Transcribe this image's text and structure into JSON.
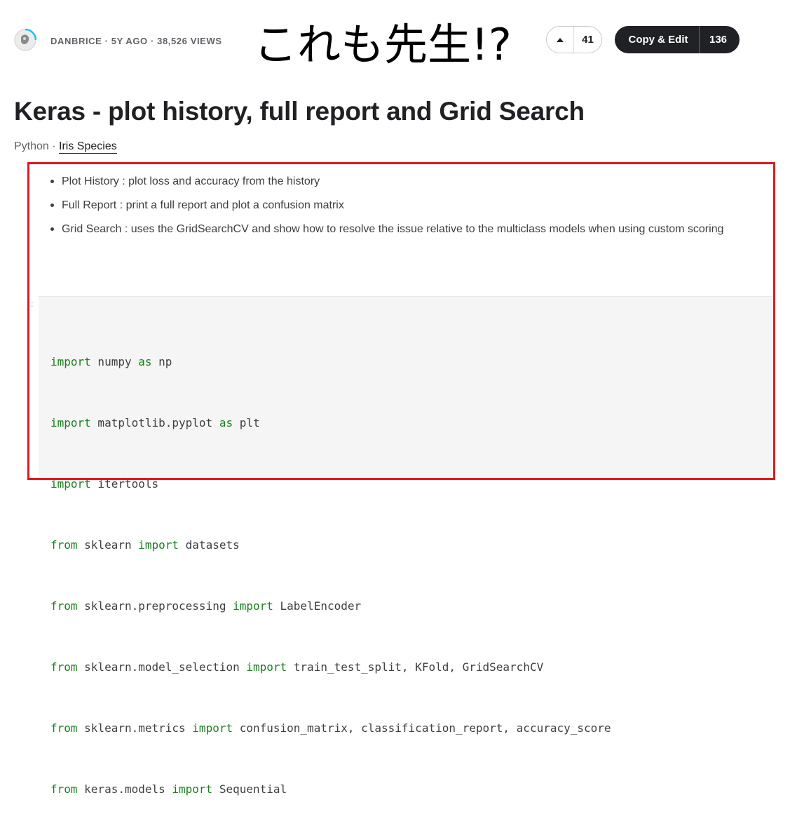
{
  "header": {
    "author_meta": "DANBRICE · 5Y AGO · 38,526 VIEWS",
    "overlay_caption": "これも先生!?",
    "vote_count": "41",
    "copy_edit_label": "Copy & Edit",
    "copy_edit_count": "136"
  },
  "notebook": {
    "title": "Keras - plot history, full report and Grid Search",
    "language": "Python",
    "separator": " · ",
    "dataset": "Iris Species"
  },
  "markdown": {
    "bullets": [
      "Plot History : plot loss and accuracy from the history",
      "Full Report : print a full report and plot a confusion matrix",
      "Grid Search : uses the GridSearchCV and show how to resolve the issue relative to the multiclass models when using custom scoring"
    ]
  },
  "code_cell": {
    "marker": ":",
    "lines": [
      {
        "k1": "import",
        "t1": " numpy ",
        "k2": "as",
        "t2": " np"
      },
      {
        "k1": "import",
        "t1": " matplotlib.pyplot ",
        "k2": "as",
        "t2": " plt"
      },
      {
        "k1": "import",
        "t1": " itertools",
        "k2": "",
        "t2": ""
      },
      {
        "k1": "from",
        "t1": " sklearn ",
        "k2": "import",
        "t2": " datasets"
      },
      {
        "k1": "from",
        "t1": " sklearn.preprocessing ",
        "k2": "import",
        "t2": " LabelEncoder"
      },
      {
        "k1": "from",
        "t1": " sklearn.model_selection ",
        "k2": "import",
        "t2": " train_test_split, KFold, GridSearchCV"
      },
      {
        "k1": "from",
        "t1": " sklearn.metrics ",
        "k2": "import",
        "t2": " confusion_matrix, classification_report, accuracy_score"
      },
      {
        "k1": "from",
        "t1": " keras.models ",
        "k2": "import",
        "t2": " Sequential"
      }
    ]
  },
  "colors": {
    "highlight_border": "#e0191f",
    "keyword": "#1a7f1f",
    "button_dark": "#202124",
    "code_background": "#f5f5f5"
  },
  "icons": {
    "avatar": "user-avatar-icon",
    "upvote": "caret-up-icon"
  }
}
